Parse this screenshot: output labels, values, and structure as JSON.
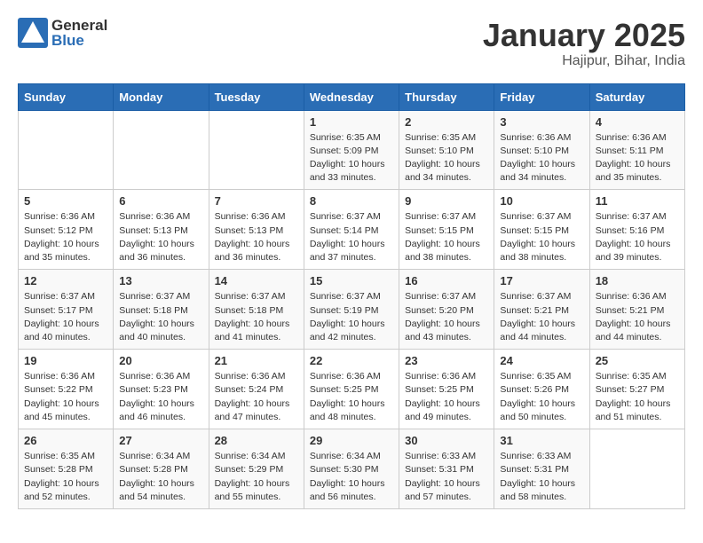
{
  "logo": {
    "general": "General",
    "blue": "Blue"
  },
  "title": "January 2025",
  "subtitle": "Hajipur, Bihar, India",
  "headers": [
    "Sunday",
    "Monday",
    "Tuesday",
    "Wednesday",
    "Thursday",
    "Friday",
    "Saturday"
  ],
  "weeks": [
    [
      {
        "day": "",
        "sunrise": "",
        "sunset": "",
        "daylight": ""
      },
      {
        "day": "",
        "sunrise": "",
        "sunset": "",
        "daylight": ""
      },
      {
        "day": "",
        "sunrise": "",
        "sunset": "",
        "daylight": ""
      },
      {
        "day": "1",
        "sunrise": "Sunrise: 6:35 AM",
        "sunset": "Sunset: 5:09 PM",
        "daylight": "Daylight: 10 hours and 33 minutes."
      },
      {
        "day": "2",
        "sunrise": "Sunrise: 6:35 AM",
        "sunset": "Sunset: 5:10 PM",
        "daylight": "Daylight: 10 hours and 34 minutes."
      },
      {
        "day": "3",
        "sunrise": "Sunrise: 6:36 AM",
        "sunset": "Sunset: 5:10 PM",
        "daylight": "Daylight: 10 hours and 34 minutes."
      },
      {
        "day": "4",
        "sunrise": "Sunrise: 6:36 AM",
        "sunset": "Sunset: 5:11 PM",
        "daylight": "Daylight: 10 hours and 35 minutes."
      }
    ],
    [
      {
        "day": "5",
        "sunrise": "Sunrise: 6:36 AM",
        "sunset": "Sunset: 5:12 PM",
        "daylight": "Daylight: 10 hours and 35 minutes."
      },
      {
        "day": "6",
        "sunrise": "Sunrise: 6:36 AM",
        "sunset": "Sunset: 5:13 PM",
        "daylight": "Daylight: 10 hours and 36 minutes."
      },
      {
        "day": "7",
        "sunrise": "Sunrise: 6:36 AM",
        "sunset": "Sunset: 5:13 PM",
        "daylight": "Daylight: 10 hours and 36 minutes."
      },
      {
        "day": "8",
        "sunrise": "Sunrise: 6:37 AM",
        "sunset": "Sunset: 5:14 PM",
        "daylight": "Daylight: 10 hours and 37 minutes."
      },
      {
        "day": "9",
        "sunrise": "Sunrise: 6:37 AM",
        "sunset": "Sunset: 5:15 PM",
        "daylight": "Daylight: 10 hours and 38 minutes."
      },
      {
        "day": "10",
        "sunrise": "Sunrise: 6:37 AM",
        "sunset": "Sunset: 5:15 PM",
        "daylight": "Daylight: 10 hours and 38 minutes."
      },
      {
        "day": "11",
        "sunrise": "Sunrise: 6:37 AM",
        "sunset": "Sunset: 5:16 PM",
        "daylight": "Daylight: 10 hours and 39 minutes."
      }
    ],
    [
      {
        "day": "12",
        "sunrise": "Sunrise: 6:37 AM",
        "sunset": "Sunset: 5:17 PM",
        "daylight": "Daylight: 10 hours and 40 minutes."
      },
      {
        "day": "13",
        "sunrise": "Sunrise: 6:37 AM",
        "sunset": "Sunset: 5:18 PM",
        "daylight": "Daylight: 10 hours and 40 minutes."
      },
      {
        "day": "14",
        "sunrise": "Sunrise: 6:37 AM",
        "sunset": "Sunset: 5:18 PM",
        "daylight": "Daylight: 10 hours and 41 minutes."
      },
      {
        "day": "15",
        "sunrise": "Sunrise: 6:37 AM",
        "sunset": "Sunset: 5:19 PM",
        "daylight": "Daylight: 10 hours and 42 minutes."
      },
      {
        "day": "16",
        "sunrise": "Sunrise: 6:37 AM",
        "sunset": "Sunset: 5:20 PM",
        "daylight": "Daylight: 10 hours and 43 minutes."
      },
      {
        "day": "17",
        "sunrise": "Sunrise: 6:37 AM",
        "sunset": "Sunset: 5:21 PM",
        "daylight": "Daylight: 10 hours and 44 minutes."
      },
      {
        "day": "18",
        "sunrise": "Sunrise: 6:36 AM",
        "sunset": "Sunset: 5:21 PM",
        "daylight": "Daylight: 10 hours and 44 minutes."
      }
    ],
    [
      {
        "day": "19",
        "sunrise": "Sunrise: 6:36 AM",
        "sunset": "Sunset: 5:22 PM",
        "daylight": "Daylight: 10 hours and 45 minutes."
      },
      {
        "day": "20",
        "sunrise": "Sunrise: 6:36 AM",
        "sunset": "Sunset: 5:23 PM",
        "daylight": "Daylight: 10 hours and 46 minutes."
      },
      {
        "day": "21",
        "sunrise": "Sunrise: 6:36 AM",
        "sunset": "Sunset: 5:24 PM",
        "daylight": "Daylight: 10 hours and 47 minutes."
      },
      {
        "day": "22",
        "sunrise": "Sunrise: 6:36 AM",
        "sunset": "Sunset: 5:25 PM",
        "daylight": "Daylight: 10 hours and 48 minutes."
      },
      {
        "day": "23",
        "sunrise": "Sunrise: 6:36 AM",
        "sunset": "Sunset: 5:25 PM",
        "daylight": "Daylight: 10 hours and 49 minutes."
      },
      {
        "day": "24",
        "sunrise": "Sunrise: 6:35 AM",
        "sunset": "Sunset: 5:26 PM",
        "daylight": "Daylight: 10 hours and 50 minutes."
      },
      {
        "day": "25",
        "sunrise": "Sunrise: 6:35 AM",
        "sunset": "Sunset: 5:27 PM",
        "daylight": "Daylight: 10 hours and 51 minutes."
      }
    ],
    [
      {
        "day": "26",
        "sunrise": "Sunrise: 6:35 AM",
        "sunset": "Sunset: 5:28 PM",
        "daylight": "Daylight: 10 hours and 52 minutes."
      },
      {
        "day": "27",
        "sunrise": "Sunrise: 6:34 AM",
        "sunset": "Sunset: 5:28 PM",
        "daylight": "Daylight: 10 hours and 54 minutes."
      },
      {
        "day": "28",
        "sunrise": "Sunrise: 6:34 AM",
        "sunset": "Sunset: 5:29 PM",
        "daylight": "Daylight: 10 hours and 55 minutes."
      },
      {
        "day": "29",
        "sunrise": "Sunrise: 6:34 AM",
        "sunset": "Sunset: 5:30 PM",
        "daylight": "Daylight: 10 hours and 56 minutes."
      },
      {
        "day": "30",
        "sunrise": "Sunrise: 6:33 AM",
        "sunset": "Sunset: 5:31 PM",
        "daylight": "Daylight: 10 hours and 57 minutes."
      },
      {
        "day": "31",
        "sunrise": "Sunrise: 6:33 AM",
        "sunset": "Sunset: 5:31 PM",
        "daylight": "Daylight: 10 hours and 58 minutes."
      },
      {
        "day": "",
        "sunrise": "",
        "sunset": "",
        "daylight": ""
      }
    ]
  ]
}
